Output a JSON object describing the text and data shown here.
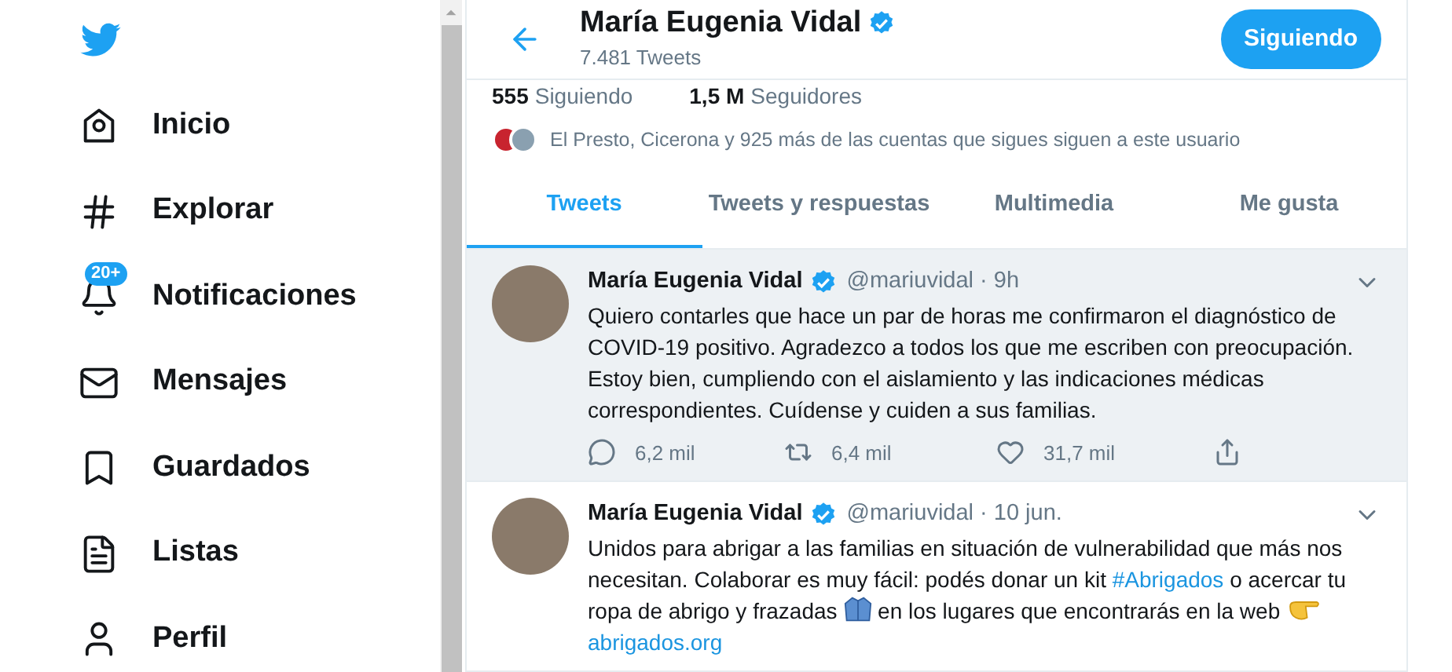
{
  "sidebar": {
    "items": [
      {
        "label": "Inicio"
      },
      {
        "label": "Explorar"
      },
      {
        "label": "Notificaciones",
        "badge": "20+"
      },
      {
        "label": "Mensajes"
      },
      {
        "label": "Guardados"
      },
      {
        "label": "Listas"
      },
      {
        "label": "Perfil"
      }
    ]
  },
  "header": {
    "name": "María Eugenia Vidal",
    "verified": true,
    "tweet_count": "7.481 Tweets",
    "follow_button": "Siguiendo"
  },
  "stats": [
    {
      "value": "555",
      "label": "Siguiendo"
    },
    {
      "value": "1,5 M",
      "label": "Seguidores"
    }
  ],
  "followed_by": "El Presto, Cicerona y 925 más de las cuentas que sigues siguen a este usuario",
  "tabs": [
    {
      "label": "Tweets",
      "selected": true
    },
    {
      "label": "Tweets y respuestas",
      "selected": false
    },
    {
      "label": "Multimedia",
      "selected": false
    },
    {
      "label": "Me gusta",
      "selected": false
    }
  ],
  "tweets": [
    {
      "name": "María Eugenia Vidal",
      "verified": true,
      "handle": "@mariuvidal",
      "separator": "·",
      "time": "9h",
      "highlighted": true,
      "body": [
        {
          "kind": "text",
          "text": "Quiero contarles que hace un par de horas me confirmaron el diagnóstico de COVID-19 positivo. Agradezco a todos los que me escriben con preocupación. Estoy bien, cumpliendo con el aislamiento y las indicaciones médicas correspondientes. Cuídense y cuiden a sus familias."
        }
      ],
      "replies": "6,2 mil",
      "retweets": "6,4 mil",
      "likes": "31,7 mil"
    },
    {
      "name": "María Eugenia Vidal",
      "verified": true,
      "handle": "@mariuvidal",
      "separator": "·",
      "time": "10 jun.",
      "highlighted": false,
      "body": [
        {
          "kind": "text",
          "text": "Unidos para abrigar a las familias en situación de vulnerabilidad que más nos necesitan. Colaborar es muy fácil: podés donar un kit "
        },
        {
          "kind": "link",
          "text": "#Abrigados"
        },
        {
          "kind": "text",
          "text": " o acercar tu ropa de abrigo y frazadas "
        },
        {
          "kind": "icon"
        },
        {
          "kind": "text",
          "text": " en los lugares que encontrarás en la web "
        },
        {
          "kind": "icon"
        },
        {
          "kind": "link",
          "text": "abrigados.org"
        }
      ]
    }
  ]
}
